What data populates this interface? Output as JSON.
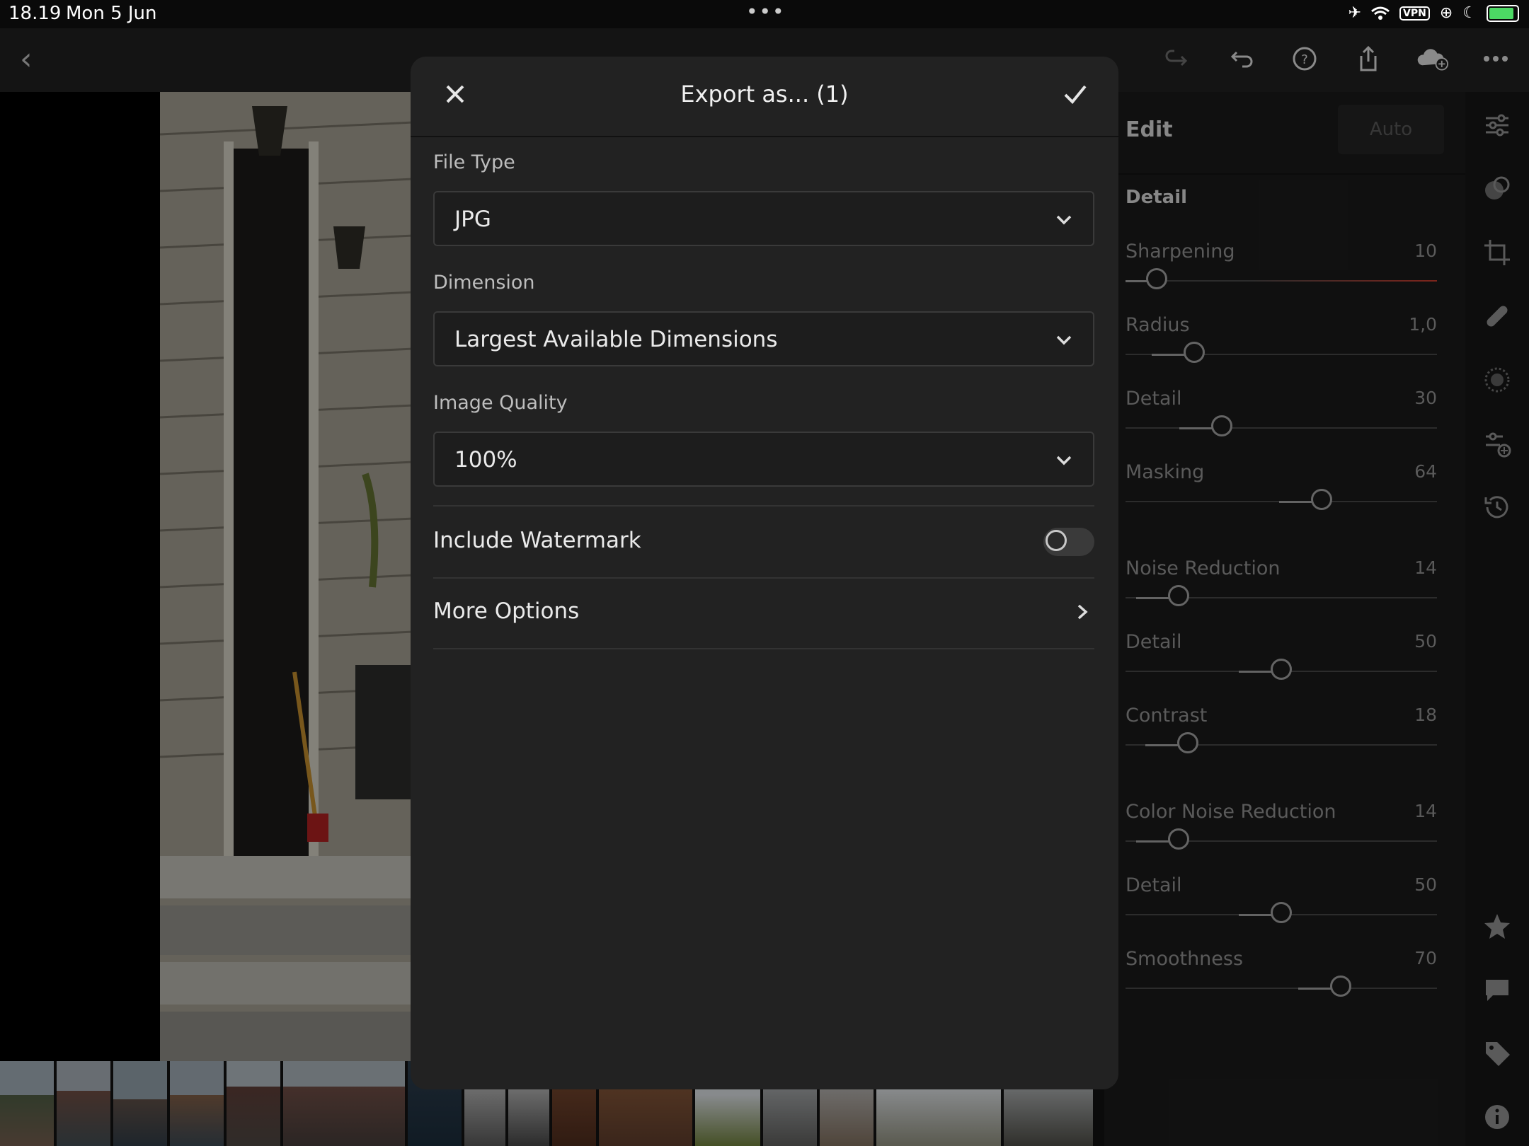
{
  "status_bar": {
    "time": "18.19",
    "date": "Mon 5 Jun",
    "center_dots": "•••",
    "vpn": "VPN"
  },
  "top_toolbar": {
    "icons": [
      "back-icon",
      "redo-icon",
      "undo-icon",
      "help-icon",
      "share-icon",
      "cloud-add-icon",
      "more-icon"
    ]
  },
  "edit_panel": {
    "title": "Edit",
    "auto_label": "Auto",
    "section": "Detail",
    "sliders": [
      {
        "label": "Sharpening",
        "value": "10",
        "level": 0.1,
        "fill_from": "left-short"
      },
      {
        "label": "Radius",
        "value": "1,0",
        "level": 0.22
      },
      {
        "label": "Detail",
        "value": "30",
        "level": 0.31
      },
      {
        "label": "Masking",
        "value": "64",
        "level": 0.63
      },
      {
        "label": "Noise Reduction",
        "value": "14",
        "level": 0.17
      },
      {
        "label": "Detail",
        "value": "50",
        "level": 0.5
      },
      {
        "label": "Contrast",
        "value": "18",
        "level": 0.2
      },
      {
        "label": "Color Noise Reduction",
        "value": "14",
        "level": 0.17
      },
      {
        "label": "Detail",
        "value": "50",
        "level": 0.5
      },
      {
        "label": "Smoothness",
        "value": "70",
        "level": 0.69
      }
    ],
    "accent": "#c0392b"
  },
  "export_dialog": {
    "title": "Export as... (1)",
    "file_type_label": "File Type",
    "file_type_value": "JPG",
    "dimension_label": "Dimension",
    "dimension_value": "Largest Available Dimensions",
    "quality_label": "Image Quality",
    "quality_value": "100%",
    "watermark_label": "Include Watermark",
    "watermark_on": false,
    "more_options_label": "More Options"
  },
  "sidebar_icons": [
    "adjust-sliders-icon",
    "masking-icon",
    "crop-icon",
    "healing-icon",
    "blur-icon",
    "presets-icon",
    "history-icon",
    "rating-star-icon",
    "comment-icon",
    "tag-icon",
    "info-icon"
  ]
}
